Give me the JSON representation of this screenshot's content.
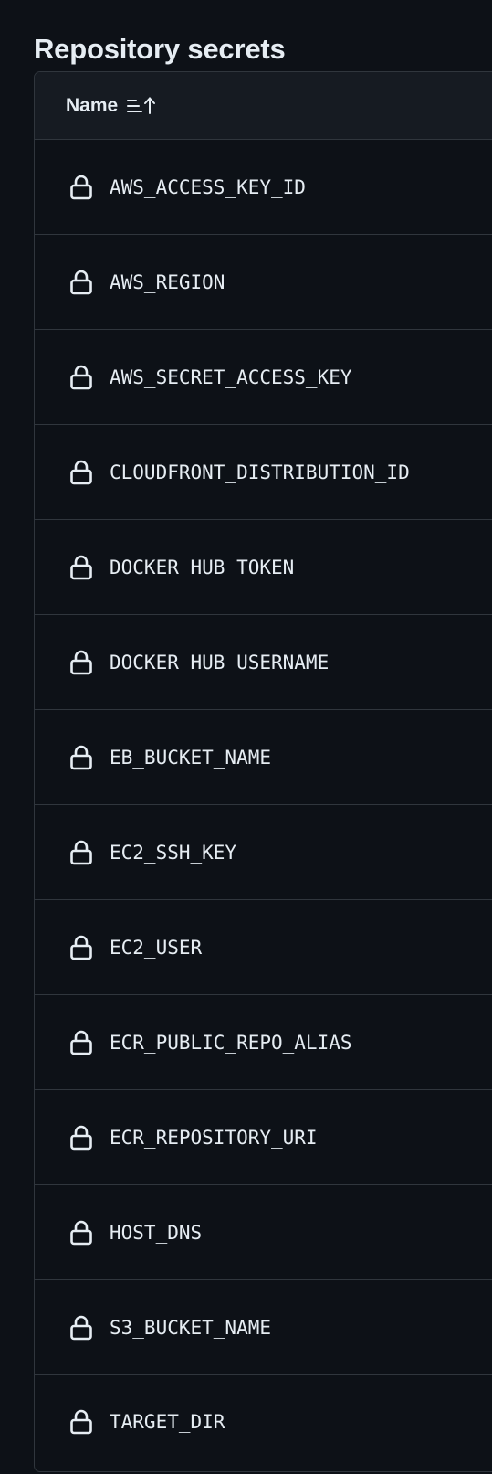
{
  "page": {
    "title": "Repository secrets"
  },
  "table": {
    "header": {
      "name_label": "Name"
    },
    "secrets": [
      {
        "name": "AWS_ACCESS_KEY_ID",
        "icon": "lock-icon"
      },
      {
        "name": "AWS_REGION",
        "icon": "lock-icon"
      },
      {
        "name": "AWS_SECRET_ACCESS_KEY",
        "icon": "lock-icon"
      },
      {
        "name": "CLOUDFRONT_DISTRIBUTION_ID",
        "icon": "lock-icon"
      },
      {
        "name": "DOCKER_HUB_TOKEN",
        "icon": "lock-icon"
      },
      {
        "name": "DOCKER_HUB_USERNAME",
        "icon": "lock-icon"
      },
      {
        "name": "EB_BUCKET_NAME",
        "icon": "lock-icon"
      },
      {
        "name": "EC2_SSH_KEY",
        "icon": "lock-icon"
      },
      {
        "name": "EC2_USER",
        "icon": "lock-icon"
      },
      {
        "name": "ECR_PUBLIC_REPO_ALIAS",
        "icon": "lock-icon"
      },
      {
        "name": "ECR_REPOSITORY_URI",
        "icon": "lock-icon"
      },
      {
        "name": "HOST_DNS",
        "icon": "lock-icon"
      },
      {
        "name": "S3_BUCKET_NAME",
        "icon": "lock-icon"
      },
      {
        "name": "TARGET_DIR",
        "icon": "lock-icon"
      }
    ]
  },
  "colors": {
    "background": "#0d1117",
    "header_background": "#161b22",
    "border": "#30363d",
    "text": "#e6edf3"
  }
}
